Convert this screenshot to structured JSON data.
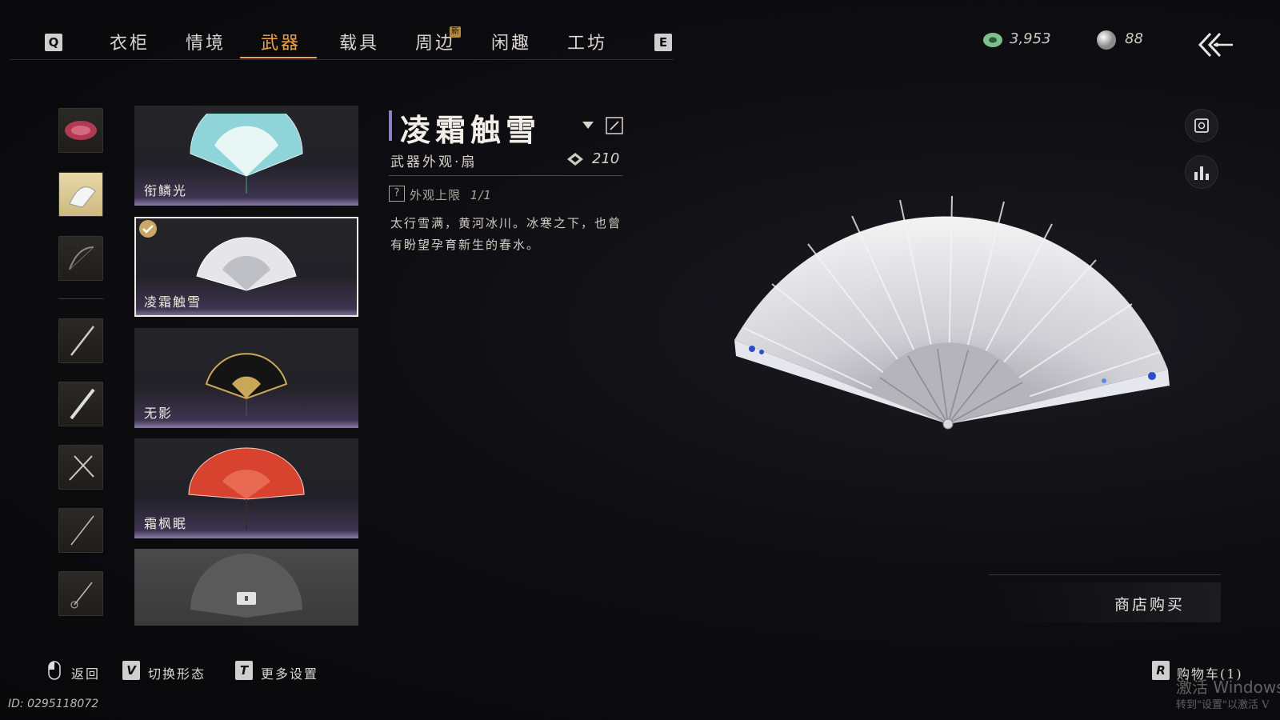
{
  "nav": {
    "left_key": "Q",
    "right_key": "E",
    "tabs": [
      {
        "label": "衣柜"
      },
      {
        "label": "情境"
      },
      {
        "label": "武器",
        "active": true
      },
      {
        "label": "载具"
      },
      {
        "label": "周边",
        "badge": "新"
      },
      {
        "label": "闲趣"
      },
      {
        "label": "工坊"
      }
    ]
  },
  "currency": {
    "jade": "3,953",
    "pearl": "88"
  },
  "items": [
    {
      "name": "衔鳞光"
    },
    {
      "name": "凌霜触雪",
      "selected": true,
      "owned": true
    },
    {
      "name": "无影"
    },
    {
      "name": "霜枫眠"
    },
    {
      "name": "",
      "locked": true
    }
  ],
  "detail": {
    "title": "凌霜触雪",
    "subtitle": "武器外观·扇",
    "score": "210",
    "limit_label": "外观上限",
    "limit_value": "1/1",
    "help_key": "?",
    "description": "太行雪满，黄河冰川。冰寒之下，也曾有盼望孕育新生的春水。"
  },
  "shop": {
    "button_label": "商店购买"
  },
  "hints": {
    "back": "返回",
    "switch_key": "V",
    "switch": "切换形态",
    "more_key": "T",
    "more": "更多设置",
    "cart_key": "R",
    "cart": "购物车(1)"
  },
  "footer": {
    "id": "ID: 0295118072",
    "watermark_line1": "激活 Windows",
    "watermark_line2": "转到\"设置\"以激活 V"
  },
  "colors": {
    "accent": "#e9a14a",
    "title_bar": "#8e7fc4",
    "card_glow": "#8a7ca6"
  }
}
